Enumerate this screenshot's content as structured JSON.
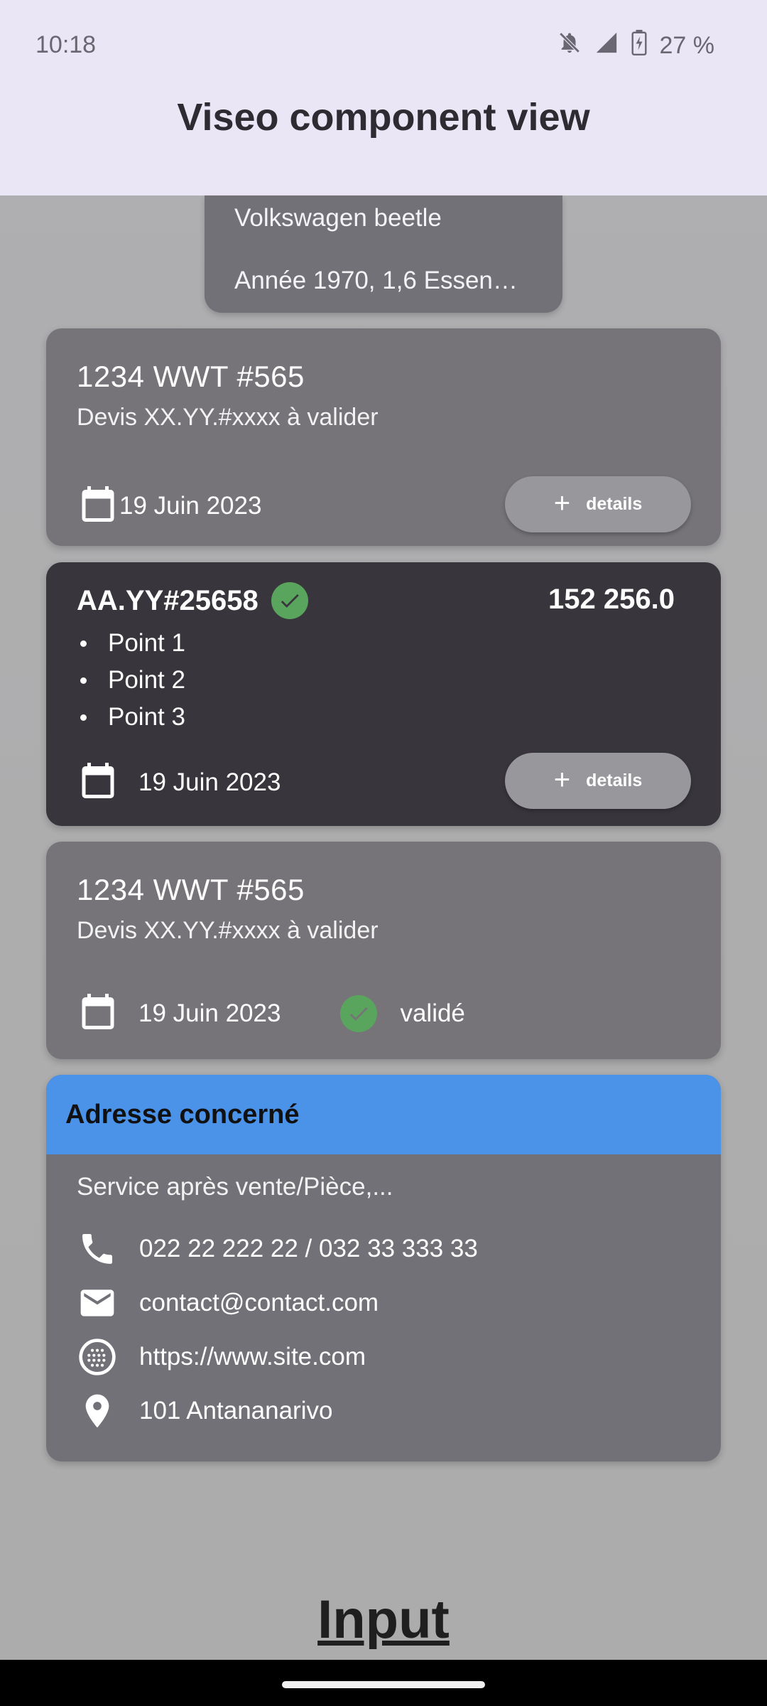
{
  "status_bar": {
    "time": "10:18",
    "battery_text": "27 %",
    "icons": [
      "bell-off-icon",
      "signal-icon",
      "battery-charging-icon"
    ]
  },
  "app_bar": {
    "title": "Viseo component view"
  },
  "vehicle": {
    "model": "Volkswagen beetle",
    "info": "Année 1970, 1,6 Essen…"
  },
  "cards": [
    {
      "plate": "1234 WWT #565",
      "subtitle": "Devis XX.YY.#xxxx à valider",
      "date": "19 Juin 2023",
      "details_label": "details"
    },
    {
      "code": "AA.YY#25658",
      "amount": "152 256.0",
      "points": [
        "Point 1",
        "Point 2",
        "Point 3"
      ],
      "date": "19 Juin 2023",
      "details_label": "details"
    },
    {
      "plate": "1234 WWT #565",
      "subtitle": "Devis XX.YY.#xxxx à valider",
      "date": "19 Juin 2023",
      "status": "validé"
    }
  ],
  "address": {
    "title": "Adresse concerné",
    "service": "Service après vente/Pièce,...",
    "phone": "022 22 222 22 / 032 33 333 33",
    "email": "contact@contact.com",
    "website": "https://www.site.com",
    "location": "101 Antananarivo"
  },
  "footer": {
    "input_label": "Input"
  },
  "colors": {
    "app_bar": "#ebe6f5",
    "card_gray": "#767479",
    "card_dark": "#38363c",
    "button": "#98979c",
    "check_green": "#5aa55e",
    "address_header": "#4a93e8"
  }
}
